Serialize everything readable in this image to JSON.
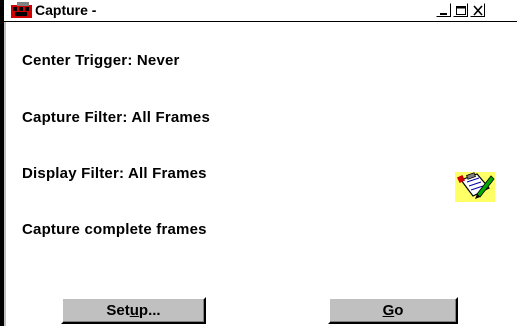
{
  "window": {
    "title": "Capture -",
    "controls": {
      "minimize_icon": "minimize-icon",
      "maximize_icon": "maximize-icon",
      "close_icon": "close-icon"
    },
    "app_icon": "capture-app-icon"
  },
  "status": {
    "center_trigger": "Center Trigger: Never",
    "capture_filter": "Capture Filter: All Frames",
    "display_filter": "Display Filter: All Frames",
    "capture_mode": "Capture complete frames"
  },
  "decor": {
    "clipboard_icon": "clipboard-pencil-icon"
  },
  "buttons": {
    "setup": {
      "prefix": "Set",
      "accel": "u",
      "suffix": "p..."
    },
    "go": {
      "prefix": "",
      "accel": "G",
      "suffix": "o"
    }
  },
  "colors": {
    "background": "#ffffff",
    "button_face": "#c0c0c0",
    "icon_accent": "#d00000",
    "clipboard_bg": "#ffff66"
  }
}
